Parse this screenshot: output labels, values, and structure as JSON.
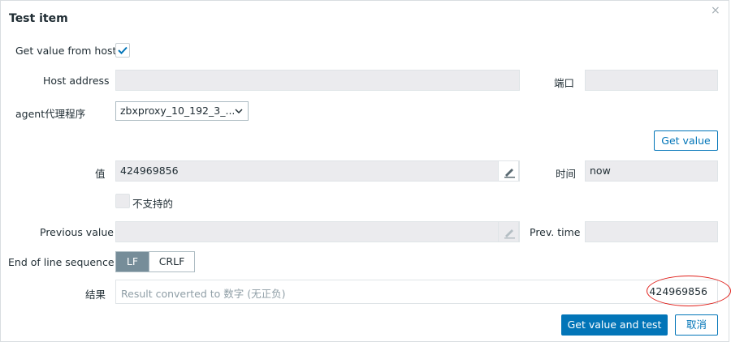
{
  "dialog": {
    "title": "Test item",
    "close_glyph": "×"
  },
  "form": {
    "get_value_from_host_label": "Get value from host",
    "get_value_from_host_checked": true,
    "host_address_label": "Host address",
    "host_address_value": "",
    "port_label": "端口",
    "port_value": "",
    "proxy_label": "agent代理程序",
    "proxy_selected": "zbxproxy_10_192_3_...",
    "get_value_button": "Get value",
    "value_label": "值",
    "value_value": "424969856",
    "time_label": "时间",
    "time_value": "now",
    "not_supported_label": "不支持的",
    "not_supported_checked": false,
    "previous_value_label": "Previous value",
    "previous_value_value": "",
    "prev_time_label": "Prev. time",
    "prev_time_value": "",
    "eol_label": "End of line sequence",
    "eol_options": [
      "LF",
      "CRLF"
    ],
    "eol_selected": "LF",
    "result_label": "结果",
    "result_hint": "Result converted to 数字 (无正负)",
    "result_value": "424969856"
  },
  "footer": {
    "test_button": "Get value and test",
    "cancel_button": "取消"
  },
  "colors": {
    "primary": "#0275b8",
    "annotation": "#e0201b",
    "readonly_bg": "#ebebee"
  }
}
